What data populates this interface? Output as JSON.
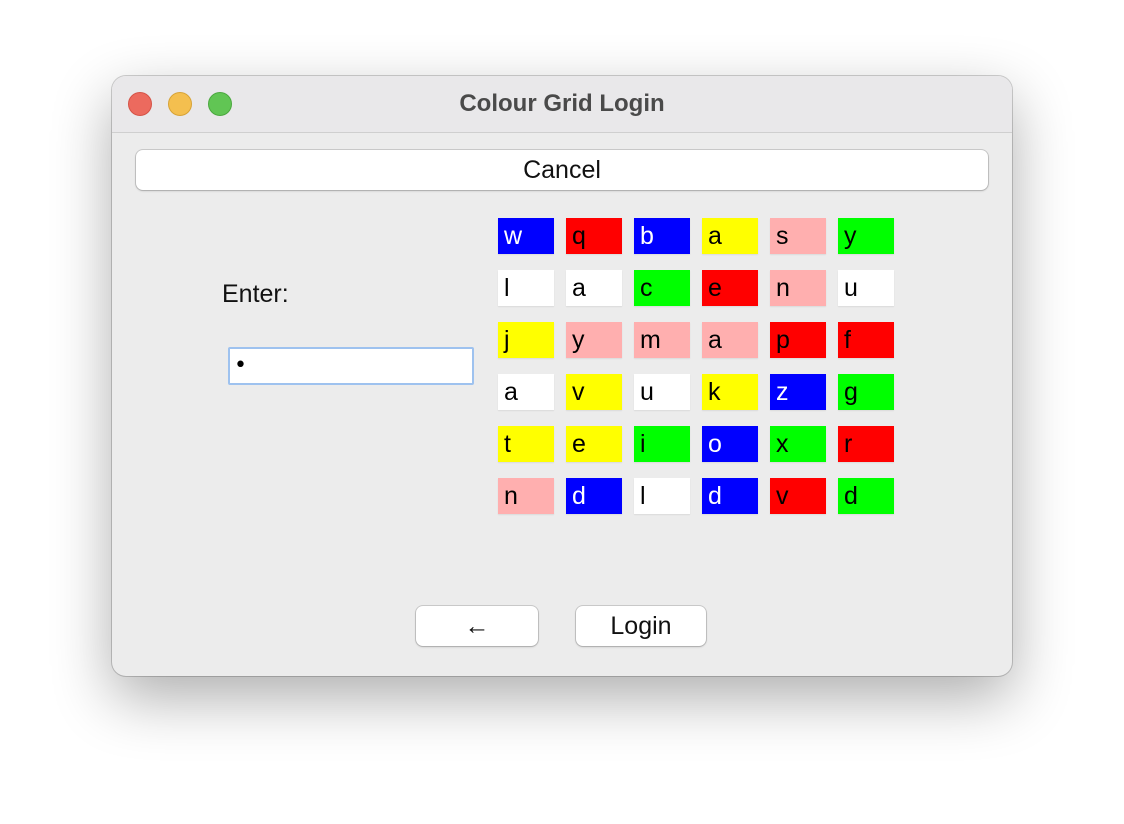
{
  "window": {
    "title": "Colour Grid Login"
  },
  "buttons": {
    "cancel_label": "Cancel",
    "back_label": "←",
    "login_label": "Login"
  },
  "form": {
    "enter_label": "Enter:",
    "password_value": "•"
  },
  "colors": {
    "blue": "#0000ff",
    "red": "#ff0000",
    "yellow": "#ffff00",
    "pink": "#ffafaf",
    "green": "#00ff00",
    "white": "#ffffff"
  },
  "grid": [
    [
      {
        "letter": "w",
        "color": "blue"
      },
      {
        "letter": "q",
        "color": "red"
      },
      {
        "letter": "b",
        "color": "blue"
      },
      {
        "letter": "a",
        "color": "yellow"
      },
      {
        "letter": "s",
        "color": "pink"
      },
      {
        "letter": "y",
        "color": "green"
      }
    ],
    [
      {
        "letter": "l",
        "color": "white"
      },
      {
        "letter": "a",
        "color": "white"
      },
      {
        "letter": "c",
        "color": "green"
      },
      {
        "letter": "e",
        "color": "red"
      },
      {
        "letter": "n",
        "color": "pink"
      },
      {
        "letter": "u",
        "color": "white"
      }
    ],
    [
      {
        "letter": "j",
        "color": "yellow"
      },
      {
        "letter": "y",
        "color": "pink"
      },
      {
        "letter": "m",
        "color": "pink"
      },
      {
        "letter": "a",
        "color": "pink"
      },
      {
        "letter": "p",
        "color": "red"
      },
      {
        "letter": "f",
        "color": "red"
      }
    ],
    [
      {
        "letter": "a",
        "color": "white"
      },
      {
        "letter": "v",
        "color": "yellow"
      },
      {
        "letter": "u",
        "color": "white"
      },
      {
        "letter": "k",
        "color": "yellow"
      },
      {
        "letter": "z",
        "color": "blue"
      },
      {
        "letter": "g",
        "color": "green"
      }
    ],
    [
      {
        "letter": "t",
        "color": "yellow"
      },
      {
        "letter": "e",
        "color": "yellow"
      },
      {
        "letter": "i",
        "color": "green"
      },
      {
        "letter": "o",
        "color": "blue"
      },
      {
        "letter": "x",
        "color": "green"
      },
      {
        "letter": "r",
        "color": "red"
      }
    ],
    [
      {
        "letter": "n",
        "color": "pink"
      },
      {
        "letter": "d",
        "color": "blue"
      },
      {
        "letter": "l",
        "color": "white"
      },
      {
        "letter": "d",
        "color": "blue"
      },
      {
        "letter": "v",
        "color": "red"
      },
      {
        "letter": "d",
        "color": "green"
      }
    ]
  ]
}
